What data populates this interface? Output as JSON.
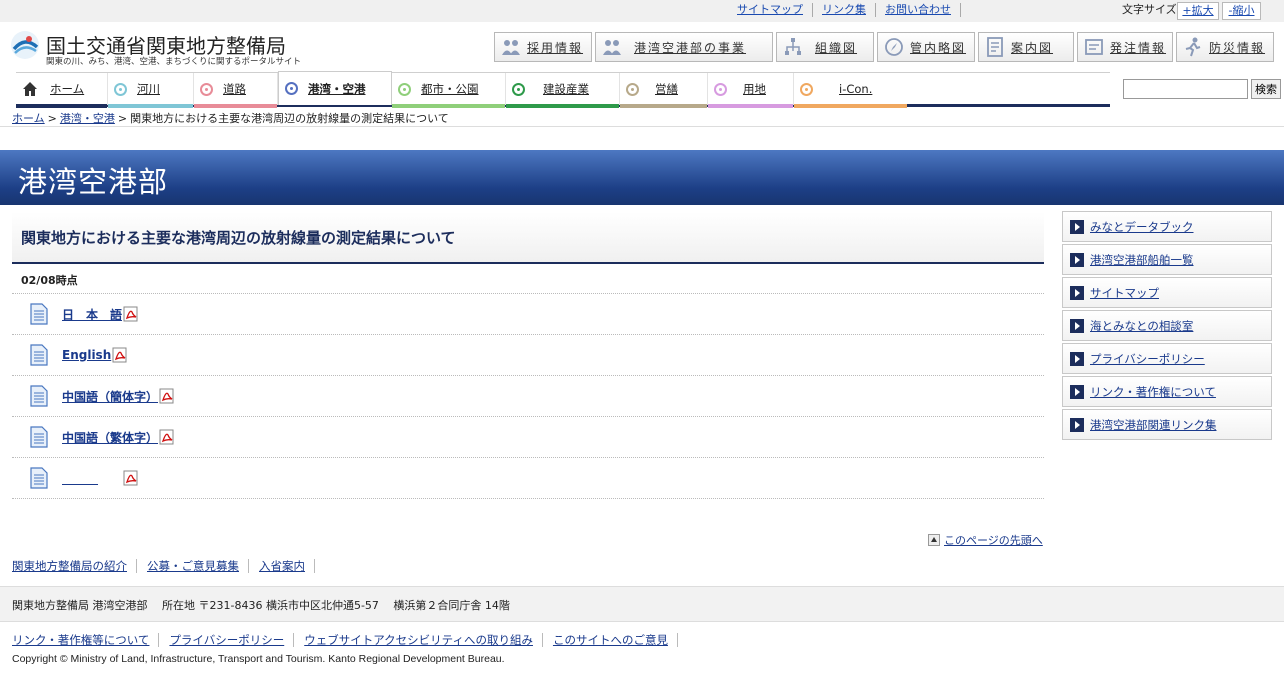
{
  "util": {
    "links": [
      "サイトマップ",
      "リンク集",
      "お問い合わせ"
    ],
    "fontsize_label": "文字サイズ",
    "enlarge": "+拡大",
    "shrink": "-縮小"
  },
  "logo": {
    "title": "国土交通省関東地方整備局",
    "tagline": "関東の川、みち、港湾、空港、まちづくりに関するポータルサイト"
  },
  "header_buttons": [
    {
      "label": "採用情報",
      "icon": "people-icon"
    },
    {
      "label": "港湾空港部の事業",
      "icon": "people-icon"
    },
    {
      "label": "組織図",
      "icon": "org-chart-icon"
    },
    {
      "label": "管内略図",
      "icon": "compass-icon"
    },
    {
      "label": "案内図",
      "icon": "map-doc-icon"
    },
    {
      "label": "発注情報",
      "icon": "order-icon"
    },
    {
      "label": "防災情報",
      "icon": "run-icon"
    }
  ],
  "nav": [
    {
      "label": "ホーム",
      "color": "#555555"
    },
    {
      "label": "河川",
      "color": "#7fc6d6"
    },
    {
      "label": "道路",
      "color": "#e88c98"
    },
    {
      "label": "港湾・空港",
      "color": "#5570c0"
    },
    {
      "label": "都市・公園",
      "color": "#8fcf7a"
    },
    {
      "label": "建設産業",
      "color": "#2e9a4a"
    },
    {
      "label": "営繕",
      "color": "#b7a98a"
    },
    {
      "label": "用地",
      "color": "#d79be0"
    },
    {
      "label": "i-Con.",
      "color": "#f0a860"
    }
  ],
  "search": {
    "button": "検索",
    "value": ""
  },
  "breadcrumb": {
    "home": "ホーム",
    "parent": "港湾・空港",
    "current": "関東地方における主要な港湾周辺の放射線量の測定結果について"
  },
  "banner": {
    "title": "港湾空港部"
  },
  "main": {
    "title": "関東地方における主要な港湾周辺の放射線量の測定結果について",
    "as_of": "02/08時点",
    "documents": [
      {
        "label": "日　本　語"
      },
      {
        "label": "English"
      },
      {
        "label": "中国語（簡体字）"
      },
      {
        "label": "中国語（繁体字）"
      },
      {
        "label": "　　　"
      }
    ],
    "page_top": "このページの先頭へ"
  },
  "side_menu": [
    "みなとデータブック",
    "港湾空港部船舶一覧",
    "サイトマップ",
    "海とみなとの相談室",
    "プライバシーポリシー",
    "リンク・著作権について",
    "港湾空港部関連リンク集"
  ],
  "footer": {
    "links": [
      "関東地方整備局の紹介",
      "公募・ご意見募集",
      "入省案内"
    ],
    "address": "関東地方整備局 港湾空港部　 所在地 〒231-8436 横浜市中区北仲通5-57　 横浜第２合同庁舎 14階",
    "bottom_links": [
      "リンク・著作権等について",
      "プライバシーポリシー",
      "ウェブサイトアクセシビリティへの取り組み",
      "このサイトへのご意見"
    ],
    "copyright": "Copyright © Ministry of Land, Infrastructure, Transport and Tourism. Kanto Regional Development Bureau."
  }
}
